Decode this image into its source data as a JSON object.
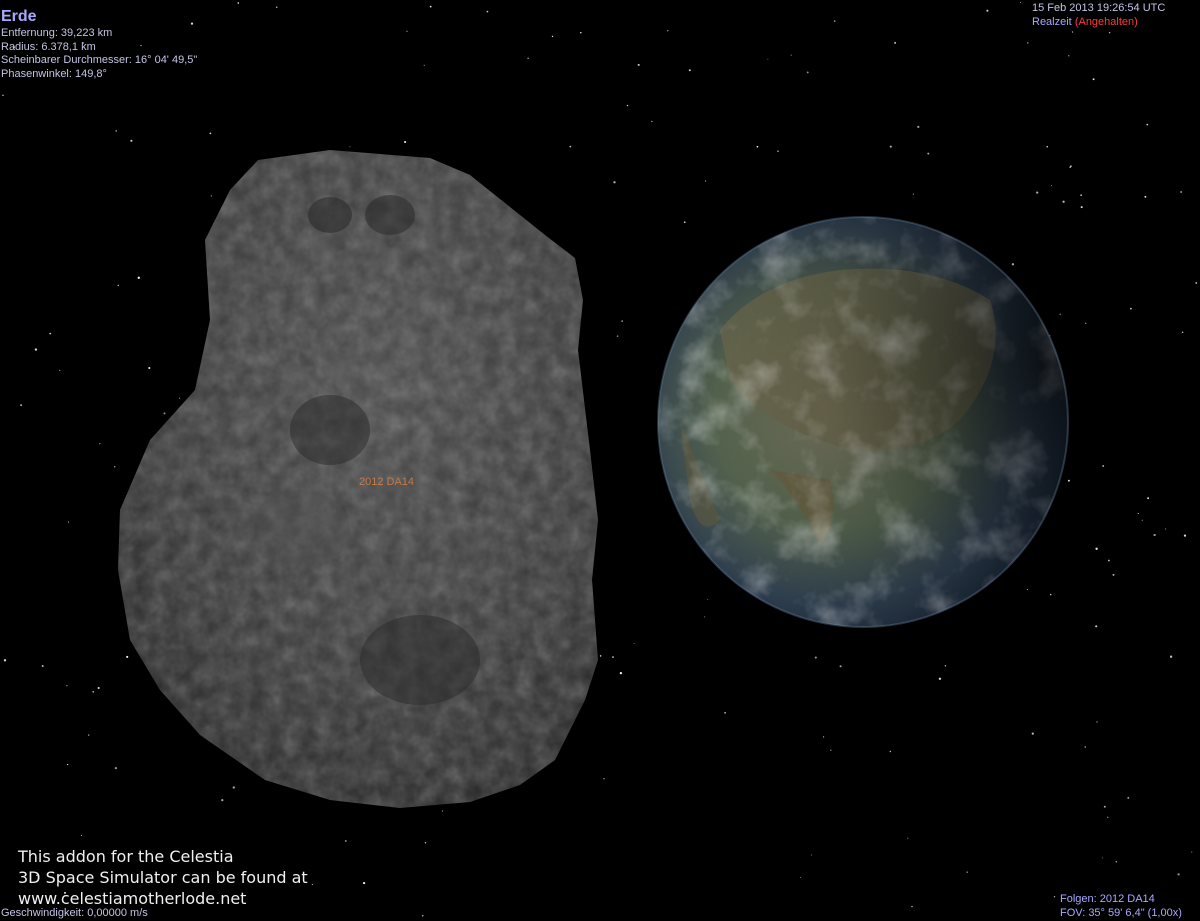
{
  "selection": {
    "name": "Erde",
    "distance": "Entfernung: 39,223 km",
    "radius": "Radius: 6.378,1 km",
    "apparent_diameter": "Scheinbarer Durchmesser: 16° 04' 49,5\"",
    "phase_angle": "Phasenwinkel: 149,8°"
  },
  "time": {
    "date": "15 Feb 2013 19:26:54 UTC",
    "mode": "Realzeit",
    "paused": "(Angehalten)"
  },
  "object_label": "2012 DA14",
  "addon_note": {
    "line1": "This addon for the Celestia",
    "line2": "3D Space Simulator can be found at",
    "line3": "www.celestiamotherlode.net"
  },
  "speed": "Geschwindigkeit: 0,00000 m/s",
  "follow": "Folgen: 2012 DA14",
  "fov": "FOV: 35° 59' 6,4\" (1,00x)",
  "colors": {
    "background": "#000000",
    "hud_text": "#c4c4e4",
    "hud_title": "#a8a8ff",
    "paused": "#ff3a3a",
    "object_label": "#c87a45"
  }
}
